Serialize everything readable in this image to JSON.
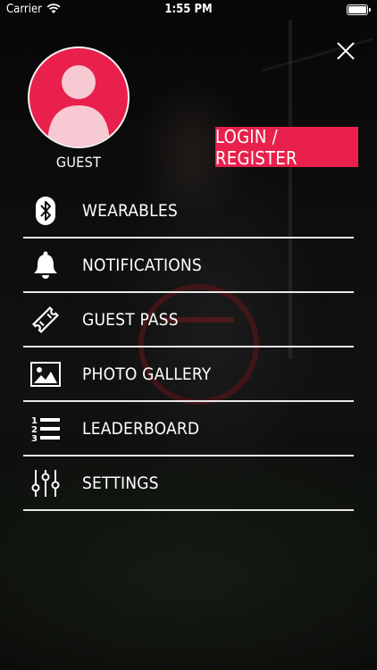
{
  "status_bar": {
    "carrier": "Carrier",
    "time": "1:55 PM"
  },
  "profile": {
    "name": "GUEST",
    "login_label": "LOGIN / REGISTER"
  },
  "menu": {
    "items": [
      {
        "label": "WEARABLES",
        "icon": "bluetooth-icon"
      },
      {
        "label": "NOTIFICATIONS",
        "icon": "bell-icon"
      },
      {
        "label": "GUEST PASS",
        "icon": "ticket-icon"
      },
      {
        "label": "PHOTO GALLERY",
        "icon": "image-icon"
      },
      {
        "label": "LEADERBOARD",
        "icon": "ranked-list-icon"
      },
      {
        "label": "SETTINGS",
        "icon": "sliders-icon"
      }
    ]
  },
  "colors": {
    "accent": "#e8204b",
    "divider": "#e8e8e8",
    "background": "#0b0b0b"
  }
}
